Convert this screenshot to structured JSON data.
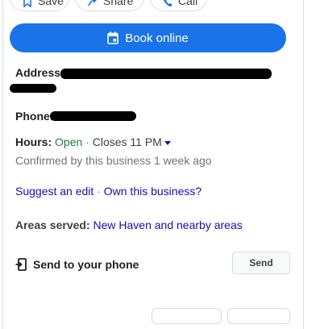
{
  "top_actions": {
    "save_label": "Save",
    "share_label": "Share",
    "call_label": "Call"
  },
  "book_button": {
    "label": "Book online"
  },
  "address": {
    "label": "Address:"
  },
  "phone": {
    "label": "Phone:"
  },
  "hours": {
    "label": "Hours:",
    "status": "Open",
    "separator": "·",
    "closes": "Closes 11 PM",
    "confirmation": "Confirmed by this business 1 week ago"
  },
  "links": {
    "suggest_edit": "Suggest an edit",
    "separator": "·",
    "own_business": "Own this business?"
  },
  "areas_served": {
    "label": "Areas served:",
    "value": "New Haven and nearby areas"
  },
  "send_to_phone": {
    "label": "Send to your phone",
    "button": "Send"
  },
  "colors": {
    "accent": "#1a73e8",
    "open": "#188038",
    "link": "#1a0dab"
  }
}
